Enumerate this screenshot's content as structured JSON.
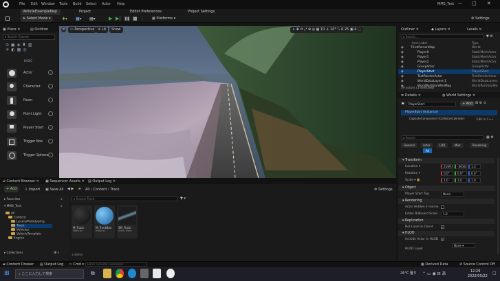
{
  "app": {
    "logo": "unreal-logo",
    "project": "VehicleExampleMap",
    "window_title": "MMS_Test"
  },
  "menu": [
    "File",
    "Edit",
    "Window",
    "Tools",
    "Build",
    "Select",
    "Actor",
    "Help"
  ],
  "doc_tabs": [
    "Project",
    "Editor Preferences",
    "Project Settings"
  ],
  "toolbar": {
    "select_mode": "Select Mode",
    "platforms": "Platforms",
    "settings": "Settings"
  },
  "place_panel": {
    "tabs": [
      "Place",
      "Outliner"
    ],
    "search_placeholder": "Search Classes",
    "basic_label": "BASIC",
    "items": [
      {
        "label": "Actor",
        "icon": "sphere-icon"
      },
      {
        "label": "Character",
        "icon": "character-icon"
      },
      {
        "label": "Pawn",
        "icon": "pawn-icon"
      },
      {
        "label": "Point Light",
        "icon": "bulb-icon"
      },
      {
        "label": "Player Start",
        "icon": "flag-icon"
      },
      {
        "label": "Trigger Box",
        "icon": "cube-icon"
      },
      {
        "label": "Trigger Sphere",
        "icon": "sphere-icon"
      }
    ]
  },
  "viewport": {
    "buttons": [
      "Perspective",
      "Lit",
      "Show"
    ],
    "snap_values": [
      "10",
      "10°",
      "0.25"
    ],
    "speed": "4"
  },
  "outliner": {
    "tabs": [
      "Outliner",
      "Layers",
      "Levels"
    ],
    "search_placeholder": "Search...",
    "col_label": "Item Label",
    "col_type": "Type",
    "rows": [
      {
        "label": "ThirdPersonMap",
        "type": "World",
        "indent": 0
      },
      {
        "label": "Player0",
        "type": "StaticMeshActor",
        "indent": 2
      },
      {
        "label": "Player1",
        "type": "StaticMeshActor",
        "indent": 2
      },
      {
        "label": "Player2",
        "type": "StaticMeshActor",
        "indent": 2
      },
      {
        "label": "GroupActor",
        "type": "GroupActor",
        "indent": 2
      },
      {
        "label": "PlayerStart",
        "type": "PlayerStart",
        "indent": 2,
        "selected": true
      },
      {
        "label": "TextRenderActor",
        "type": "TextRenderActor",
        "indent": 2
      },
      {
        "label": "WorldDataLayers-1",
        "type": "WorldDataLayers",
        "indent": 2
      },
      {
        "label": "WorldPartitionMiniMap",
        "type": "WorldPartitionMini",
        "indent": 2
      }
    ],
    "summary": "59 actors (1 selected)"
  },
  "details": {
    "tabs": [
      "Details",
      "World Settings"
    ],
    "actor_name": "PlayerStart",
    "add_button": "+ Add",
    "component_root": "PlayerStart (Instance)",
    "component_child": "CapsuleComponent (CollisionCylinder)",
    "edit_in_cpp": "Edit in C++",
    "search_placeholder": "Search",
    "filters": [
      "General",
      "Actor",
      "LOD",
      "Misc",
      "Rendering",
      "All"
    ],
    "sections": {
      "transform": "Transform",
      "object": "Object",
      "rendering": "Rendering",
      "replication": "Replication",
      "hlod": "HLOD"
    },
    "props": {
      "location": "Location",
      "rotation": "Rotation",
      "scale": "Scale",
      "player_start_tag": "Player Start Tag",
      "actor_hidden": "Actor Hidden In Game",
      "editor_billboard": "Editor Billboard Scale",
      "net_load_client": "Net Load on Client",
      "include_in_hlod": "Include Actor in HLOD",
      "hlod_layer": "HLOD Layer"
    },
    "values": {
      "location": [
        "2169.0",
        "-3630.0",
        "1.3"
      ],
      "rotation": [
        "0.0°",
        "0.0°",
        "0.0°"
      ],
      "scale": [
        "1.0",
        "1.0",
        "1.0"
      ],
      "tag": "None",
      "billboard": "1.0",
      "hlod_layer": "None"
    }
  },
  "content": {
    "tabs": [
      "Content Browser",
      "Sequencer Assets",
      "Output Log"
    ],
    "add_button": "+ Add",
    "import_button": "Import",
    "save_all": "Save All",
    "breadcrumb": [
      "All",
      "Content",
      "Track"
    ],
    "settings": "Settings",
    "favorites": "Favorites",
    "project": "MMS_Test",
    "tree": [
      "All",
      "Content",
      "Levels/Prototyping",
      "Track",
      "Vehicles",
      "VehicleTemplate",
      "Engine"
    ],
    "search_placeholder": "Search Track",
    "assets": [
      {
        "label": "M_Track",
        "type": "Material"
      },
      {
        "label": "M_TrackBox",
        "type": "Material"
      },
      {
        "label": "SM_Track",
        "type": "Static Mesh"
      }
    ],
    "item_count": "3 items",
    "collections": "Collections"
  },
  "status": {
    "content_drawer": "Content Drawer",
    "output_log": "Output Log",
    "cmd": "Cmd",
    "console_placeholder": "Enter Console Command",
    "derived": "Derived Data",
    "source_control": "Source Control Off"
  },
  "taskbar": {
    "search_placeholder": "ここに入力して検索",
    "weather": "26°C 曇り",
    "time": "12:29",
    "date": "2023/05/22"
  }
}
